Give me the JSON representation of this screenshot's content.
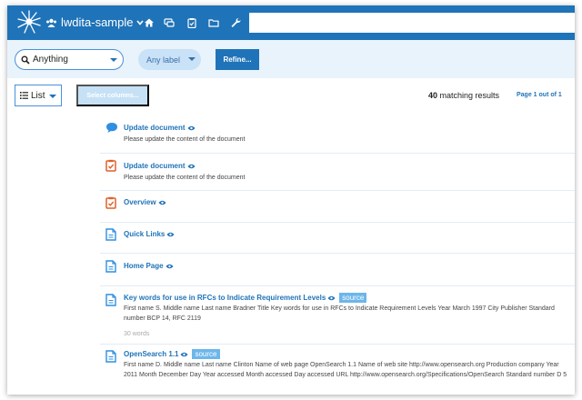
{
  "header": {
    "project_name": "lwdita-sample",
    "nav_icons": [
      "home-icon",
      "chat-icon",
      "clipboard-icon",
      "folder-icon",
      "wrench-icon"
    ],
    "search": {
      "value": "",
      "placeholder": ""
    }
  },
  "filters": {
    "type_value": "Anything",
    "label_value": "Any label",
    "refine_label": "Refine..."
  },
  "toolbar": {
    "view_value": "List",
    "select_columns_label": "Select columns...",
    "match_count": "40",
    "match_suffix": " matching results",
    "page_info": "Page 1 out of 1"
  },
  "results": [
    {
      "icon": "comment-icon",
      "title": "Update document",
      "desc": "Please update the content of the document"
    },
    {
      "icon": "task-icon",
      "title": "Update document",
      "desc": "Please update the content of the document"
    },
    {
      "icon": "task-icon",
      "title": "Overview"
    },
    {
      "icon": "document-icon",
      "title": "Quick Links"
    },
    {
      "icon": "document-icon",
      "title": "Home Page"
    },
    {
      "icon": "document-icon",
      "title": "Key words for use in RFCs to Indicate Requirement Levels",
      "badge": "source",
      "desc": "First name S. Middle name Last name Bradner Title Key words for use in RFCs to Indicate Requirement Levels Year March 1997 City Publisher Standard number BCP 14, RFC 2119",
      "words": "30 words"
    },
    {
      "icon": "document-icon",
      "title": "OpenSearch 1.1",
      "badge": "source",
      "desc": "First name D. Middle name Last name Clinton Name of web page OpenSearch 1.1 Name of web site http://www.opensearch.org Production company Year 2011 Month December Day Year accessed Month accessed Day accessed URL http://www.opensearch.org/Specifications/OpenSearch Standard number D 5"
    }
  ]
}
